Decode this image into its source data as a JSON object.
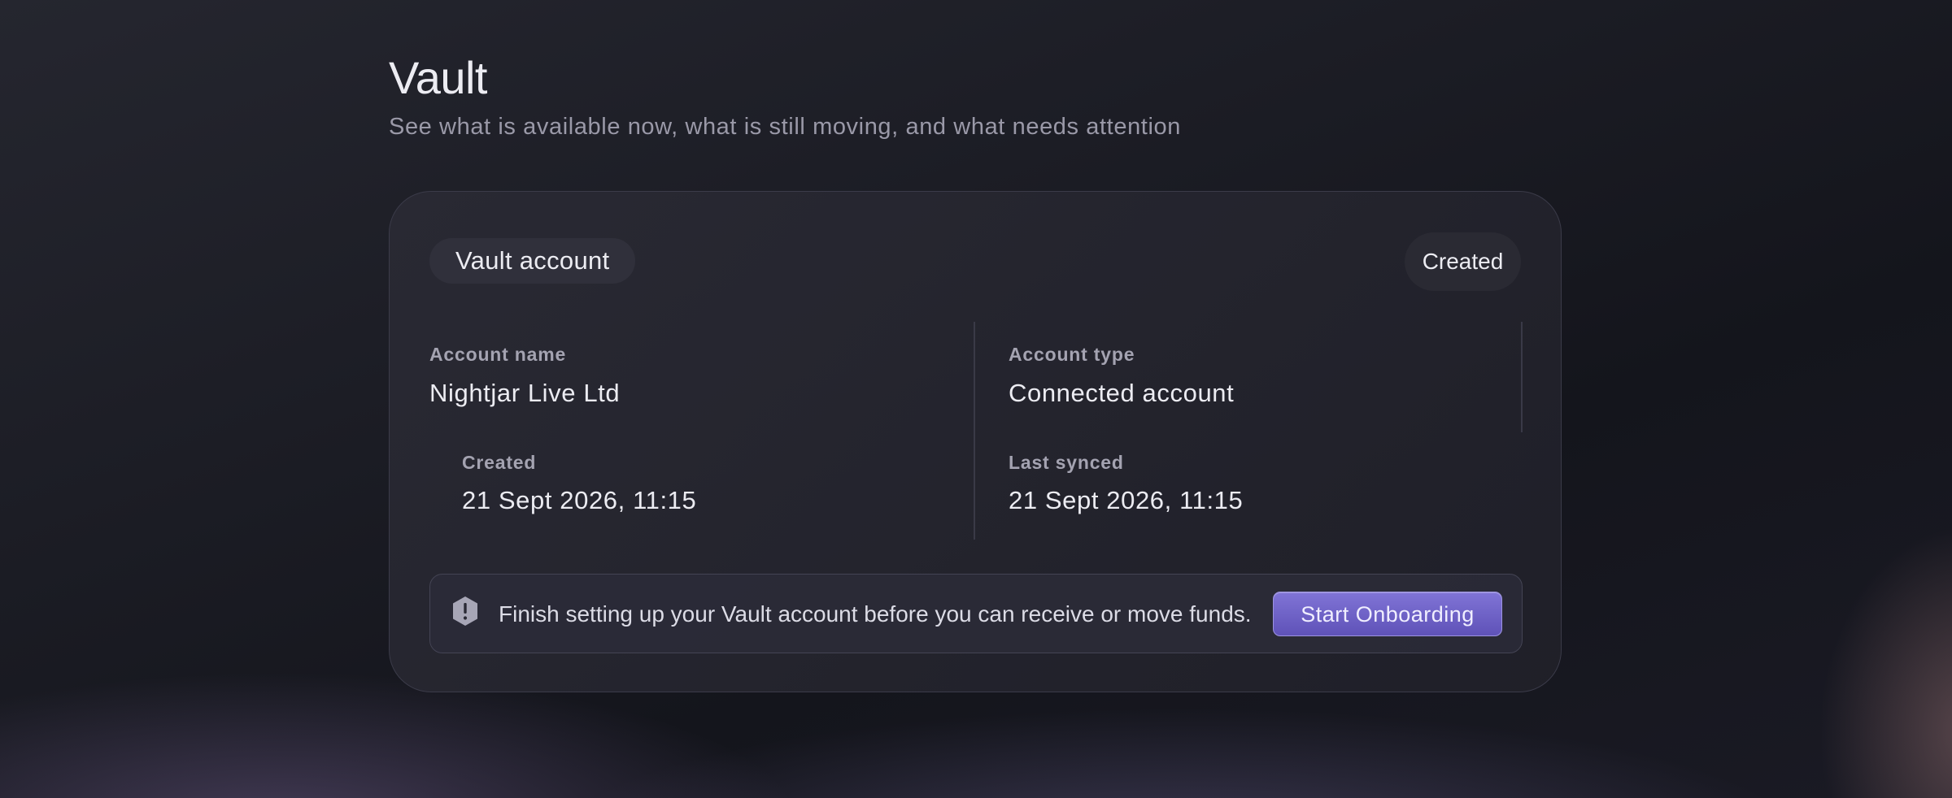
{
  "page": {
    "title": "Vault",
    "subtitle": "See what is available now, what is still moving, and what needs attention"
  },
  "card": {
    "pill_label": "Vault account",
    "status": "Created",
    "fields": {
      "account_name": {
        "label": "Account name",
        "value": "Nightjar Live Ltd"
      },
      "account_type": {
        "label": "Account type",
        "value": "Connected account"
      },
      "created": {
        "label": "Created",
        "value": "21 Sept 2026, 11:15"
      },
      "last_synced": {
        "label": "Last synced",
        "value": "21 Sept 2026, 11:15"
      }
    },
    "alert": {
      "icon": "warning-hexagon-icon",
      "text": "Finish setting up your Vault account before you can receive or move funds.",
      "button_label": "Start Onboarding"
    }
  },
  "colors": {
    "accent": "#6f63c7",
    "card_border": "#3b3b49",
    "label": "#a4a3b1",
    "text": "#ececf2"
  }
}
